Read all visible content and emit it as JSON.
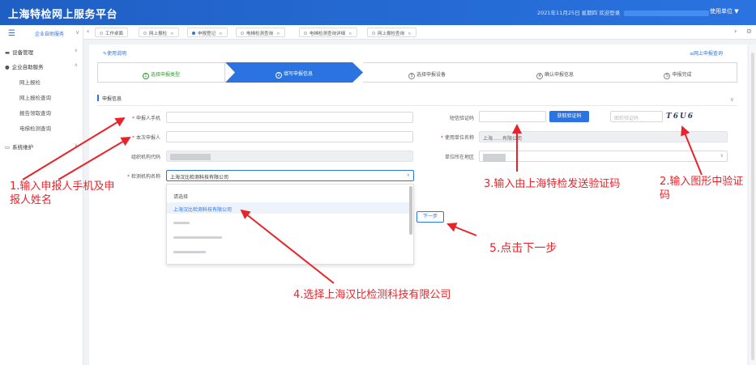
{
  "header": {
    "title": "上海特检网上服务平台",
    "datetime": "2021年11月25日 星期四",
    "welcome": "欢迎登录",
    "unit_label": "使用单位 ▼"
  },
  "sidebar": {
    "header_label": "企业自助服务",
    "groups": [
      {
        "label": "设备管理"
      },
      {
        "label": "企业自助服务"
      },
      {
        "label": "系统维护"
      }
    ],
    "sub_items": [
      "网上报检",
      "网上报检查询",
      "报告领取查询",
      "电梯检测查询"
    ]
  },
  "tabs": [
    {
      "label": "工作桌面"
    },
    {
      "label": "网上报检"
    },
    {
      "label": "申报登记"
    },
    {
      "label": "电梯检测查询"
    },
    {
      "label": "电梯检测查询详细"
    },
    {
      "label": "网上报检查询"
    }
  ],
  "main": {
    "usage_link": "使用说明",
    "online_query_link": "网上申报查询",
    "steps": [
      {
        "num": "1",
        "label": "选择申报类型"
      },
      {
        "num": "2",
        "label": "填写申报信息"
      },
      {
        "num": "3",
        "label": "选择申报设备"
      },
      {
        "num": "4",
        "label": "确认申报信息"
      },
      {
        "num": "5",
        "label": "申报完成"
      }
    ],
    "section_title": "申报信息",
    "form": {
      "applicant_phone_label": "申报人手机",
      "applicant_name_label": "本次申报人",
      "org_code_label": "组织机构代码",
      "inspection_org_label": "检测机构名称",
      "inspection_org_value": "上海汉比检测科技有限公司",
      "sms_code_label": "短信验证码",
      "sms_button": "获取验证码",
      "captcha_placeholder": "图形验证码",
      "captcha_text": "T6U6",
      "user_unit_label": "使用单位名称",
      "user_unit_value": "上海……有限公司",
      "region_label": "单位所在地区"
    },
    "dropdown": {
      "placeholder": "请选择",
      "selected": "上海汉比检测科技有限公司"
    },
    "next_button": "下一步"
  },
  "annotations": {
    "a1": "1.输入申报人手机及申报人姓名",
    "a2": "2.输入图形中验证码",
    "a3": "3.输入由上海特检发送验证码",
    "a4": "4.选择上海汉比检测科技有限公司",
    "a5": "5.点击下一步"
  },
  "colors": {
    "brand": "#2a73e0",
    "annotation": "#e8242a",
    "step_done": "#2a9d2a"
  }
}
